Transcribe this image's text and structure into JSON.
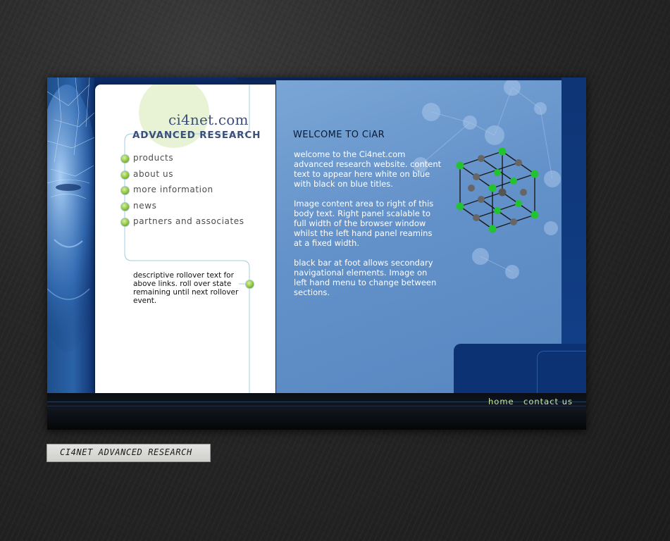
{
  "site": {
    "logo_text": "ci4net.com",
    "logo_subtitle": "ADVANCED RESEARCH"
  },
  "nav": {
    "items": [
      {
        "label": "products"
      },
      {
        "label": "about us"
      },
      {
        "label": "more information"
      },
      {
        "label": "news"
      },
      {
        "label": "partners and associates"
      }
    ]
  },
  "rollover_text": "descriptive rollover text for above links.  roll over state remaining until next rollover event.",
  "content": {
    "title": "WELCOME TO CiAR",
    "paragraphs": [
      "welcome to the Ci4net.com advanced research website. content text to appear here white on blue with black on blue titles.",
      "Image content area to right of this body text.  Right panel scalable to full width of the browser window whilst the left hand panel reamins at a fixed width.",
      "black bar at foot allows secondary navigational elements.  Image on left hand menu to change between sections."
    ]
  },
  "footer": {
    "home_label": "home",
    "contact_label": "contact us"
  },
  "caption_tag": "CI4NET  ADVANCED  RESEARCH",
  "colors": {
    "panel_blue": "#6391c9",
    "dark_blue": "#0d3273",
    "link_green": "#cfe6a8",
    "bullet_green": "#8fc43e"
  }
}
